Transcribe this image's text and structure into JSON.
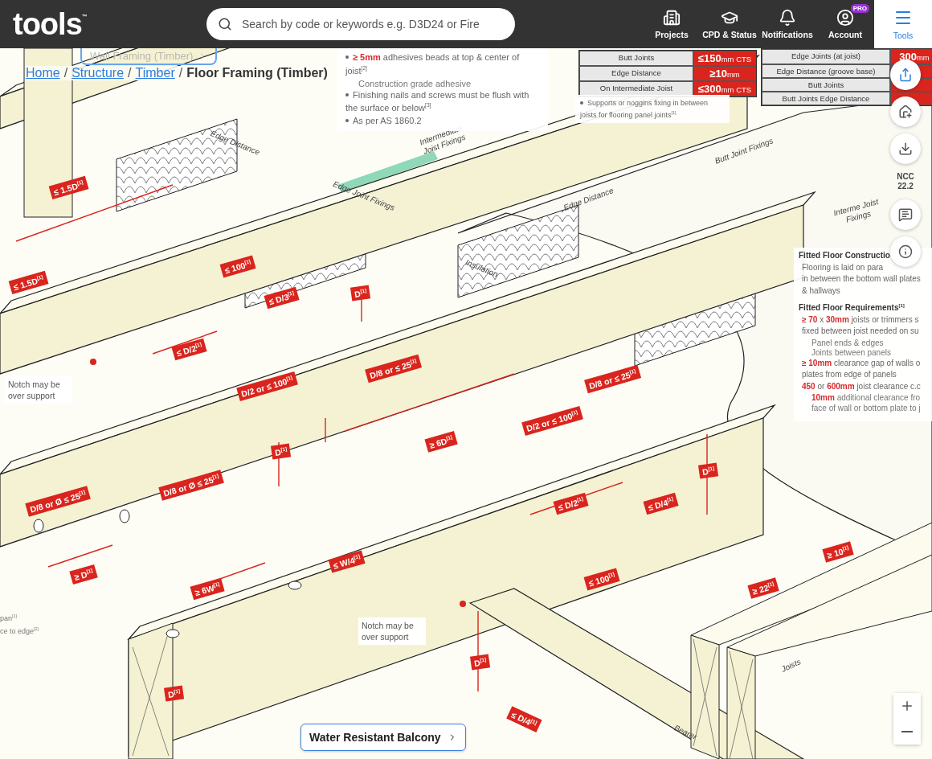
{
  "header": {
    "logo": "tools",
    "logo_mark": "™",
    "search": {
      "placeholder": "Search by code or keywords e.g. D3D24 or Fire"
    },
    "nav": [
      {
        "label": "Projects",
        "selected": false
      },
      {
        "label": "CPD & Status",
        "selected": false
      },
      {
        "label": "Notifications",
        "selected": false
      },
      {
        "label": "Account",
        "selected": false,
        "badge": "PRO"
      },
      {
        "label": "Tools",
        "selected": true
      }
    ]
  },
  "previous_page": "Wall Framing (Timber)",
  "breadcrumb": {
    "links": [
      "Home",
      "Structure",
      "Timber"
    ],
    "separator": "/",
    "current": "Floor Framing (Timber)"
  },
  "notes_top": [
    {
      "text": "**≥ 5mm** adhesives beads at top & center of joist$^{[2]}$",
      "children": [
        "Construction grade adhesive"
      ]
    },
    {
      "text": "Finishing nails and screws must be flush with the surface or below$^{[3]}$"
    },
    {
      "text": "As per AS 1860.2"
    }
  ],
  "table_1": {
    "rows": [
      {
        "label": "Butt Joints",
        "value": "**≤150**mm CTS"
      },
      {
        "label": "Edge Distance",
        "value": "**≥10**mm"
      },
      {
        "label": "On Intermediate Joist",
        "value": "**≤300**mm CTS"
      }
    ],
    "note": "Supports or noggins fixing in between joists for flooring panel joints$^{[1]}$"
  },
  "table_2": {
    "rows": [
      {
        "label": "Edge Joints (at joist)",
        "value": "**300**mm"
      },
      {
        "label": "Edge Distance (groove base)"
      },
      {
        "label": "Butt Joints"
      },
      {
        "label": "Butt Joints Edge Distance"
      }
    ]
  },
  "side_notes": [
    {
      "title": "Fitted Floor Constructio",
      "items": [
        {
          "text": "Flooring is laid on para"
        },
        {
          "text": "in between the bottom wall plates"
        },
        {
          "text": "& hallways"
        }
      ]
    },
    {
      "title": "Fitted Floor Requirements$^{[1]}$",
      "items": [
        {
          "text": "**≥ 70** x **30mm** joists or trimmers s"
        },
        {
          "text": "fixed between joist needed on su",
          "children": [
            "Panel ends & edges",
            "Joints between panels"
          ]
        },
        {
          "text": "**≥ 10mm** clearance gap of walls o"
        },
        {
          "text": "plates from edge of panels"
        },
        {
          "text": "**450** or **600mm** joist clearance c.c",
          "children": [
            "**10mm** additional clearance fro",
            "face of wall or bottom plate to j"
          ]
        }
      ]
    }
  ],
  "left_notes": [
    "pan$^{[1]}$",
    "ce to edge$^{[2]}$"
  ],
  "drawing_labels": [
    "Edge Distance",
    "Edge Joint Fixings",
    "Intermediate Joist Fixings",
    "Butt Joint Fixings",
    "Edge Distance",
    "Interme Joist Fixings",
    "Insulation",
    "Joists",
    "Bearer"
  ],
  "tags": [
    "≤ 1.5D$^{[1]}$",
    "≤ 1.5D$^{[1]}$",
    "≤ 100$^{[1]}$",
    "≤ D/3$^{[1]}$",
    "D$^{[1]}$",
    "≤ D/2$^{[1]}$",
    "D/2 or ≤ 100$^{[1]}$",
    "D/8 or ≤ 25$^{[1]}$",
    "≥ 6D$^{[1]}$",
    "D/2 or ≤ 100$^{[1]}$",
    "D/8 or ≤ 25$^{[1]}$",
    "D$^{[1]}$",
    "D$^{[1]}$",
    "D/8 or Ø ≤ 25$^{[1]}$",
    "D/8 or Ø ≤ 25$^{[1]}$",
    "≥ D$^{[1]}$",
    "≥ 6W$^{[1]}$",
    "≤ W/4$^{[1]}$",
    "≤ D/2$^{[1]}$",
    "≤ D/4$^{[1]}$",
    "≤ 100$^{[1]}$",
    "≥ 10$^{[1]}$",
    "≥ 22$^{[1]}$",
    "D$^{[1]}$",
    "D$^{[1]}$",
    "≤ D/4$^{[1]}$"
  ],
  "notch_notes": [
    "Notch may be over support",
    "Notch may be over support"
  ],
  "toolbar": {
    "edition": "NCC 22.2"
  },
  "next_page": "Water Resistant Balcony"
}
